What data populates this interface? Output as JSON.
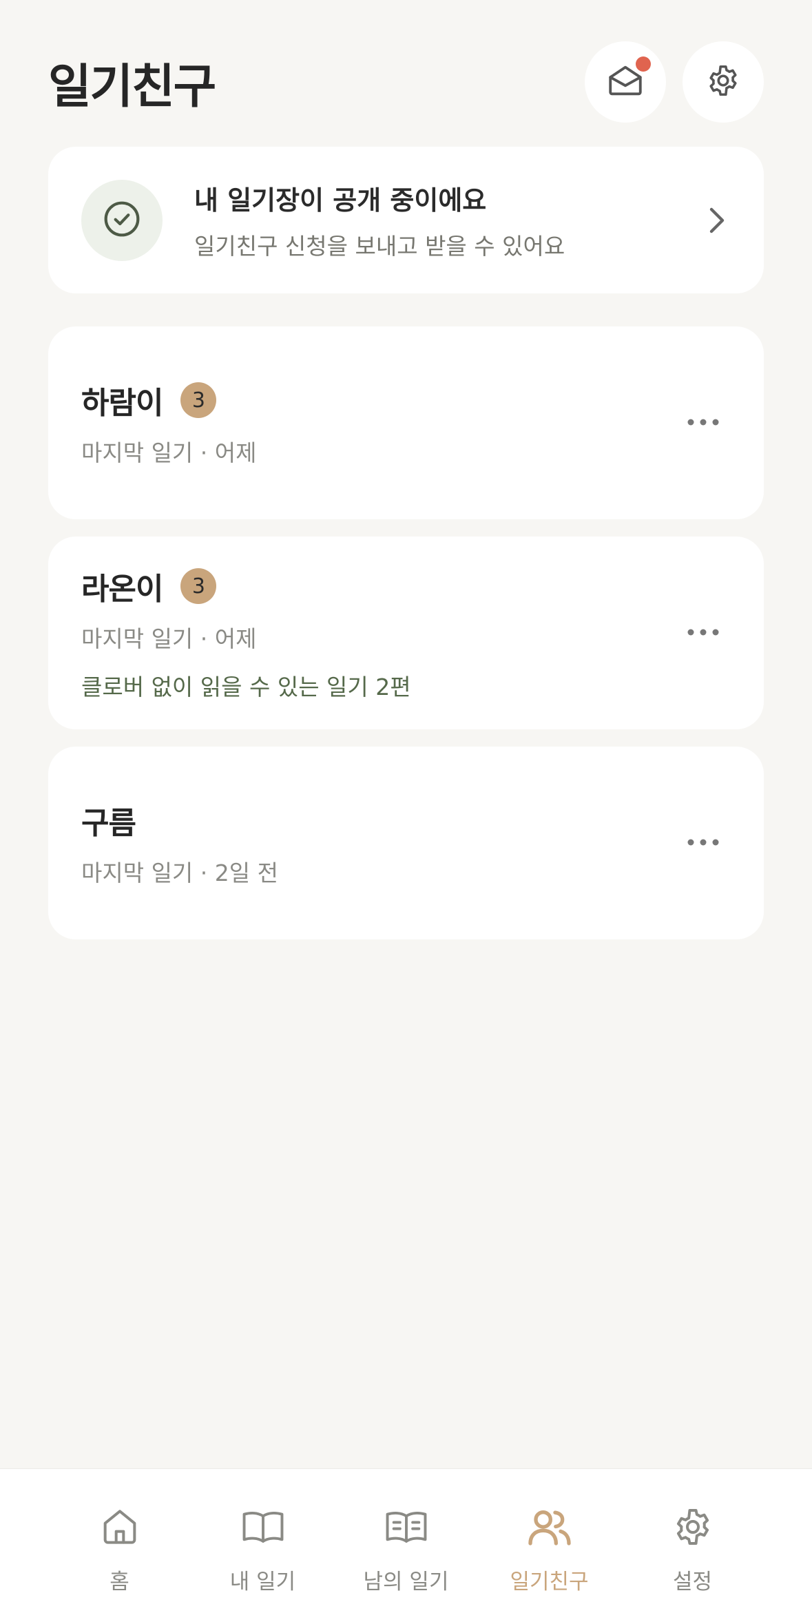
{
  "header": {
    "title": "일기친구",
    "mail_icon": "mail-open-icon",
    "settings_icon": "gear-icon"
  },
  "status_card": {
    "title": "내 일기장이 공개 중이에요",
    "subtitle": "일기친구 신청을 보내고 받을 수 있어요",
    "icon": "check-circle-icon"
  },
  "friends": [
    {
      "name": "하람이",
      "badge": "3",
      "last": "마지막 일기 · 어제",
      "note": ""
    },
    {
      "name": "라온이",
      "badge": "3",
      "last": "마지막 일기 · 어제",
      "note": "클로버 없이 읽을 수 있는 일기 2편"
    },
    {
      "name": "구름",
      "badge": "",
      "last": "마지막 일기 · 2일 전",
      "note": ""
    }
  ],
  "nav": {
    "items": [
      {
        "label": "홈",
        "icon": "home-icon"
      },
      {
        "label": "내 일기",
        "icon": "book-open-icon"
      },
      {
        "label": "남의 일기",
        "icon": "book-lines-icon"
      },
      {
        "label": "일기친구",
        "icon": "users-icon"
      },
      {
        "label": "설정",
        "icon": "gear-icon"
      }
    ],
    "active_index": 3
  },
  "colors": {
    "accent": "#c9a57c",
    "notification": "#e0644f",
    "note_green": "#55694a",
    "background": "#f7f6f3"
  }
}
